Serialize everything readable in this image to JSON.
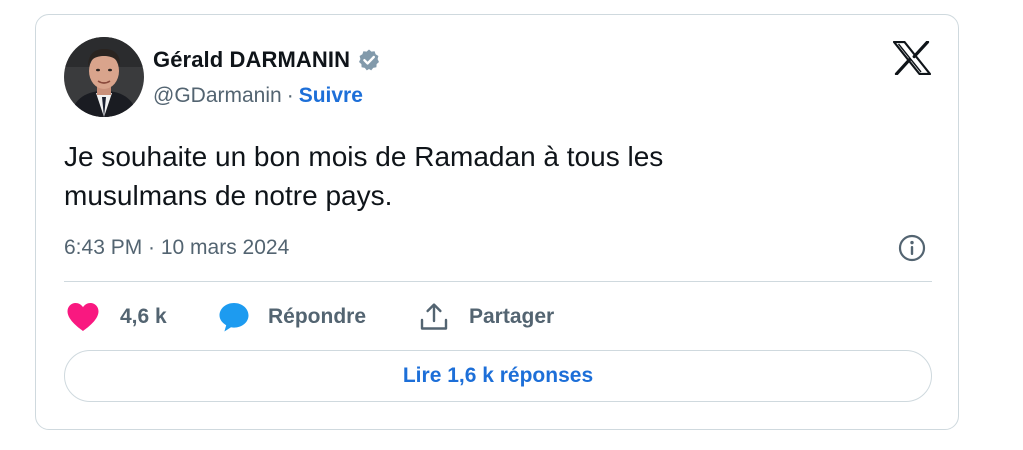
{
  "author": {
    "display_name": "Gérald DARMANIN",
    "handle": "@GDarmanin",
    "separator": "·",
    "follow_label": "Suivre",
    "verified": true,
    "verified_color": "#829aab"
  },
  "tweet": {
    "text_line_1": "Je souhaite un bon mois de Ramadan à tous les",
    "text_line_2": "musulmans de notre pays.",
    "timestamp": "6:43 PM · 10 mars 2024"
  },
  "actions": {
    "like_count": "4,6 k",
    "reply_label": "Répondre",
    "share_label": "Partager"
  },
  "replies_button_label": "Lire 1,6 k réponses",
  "colors": {
    "accent": "#1d6fd8",
    "like": "#f91880",
    "reply": "#1d9bf0",
    "muted_text": "#536471",
    "border": "#cfd9de"
  },
  "icons": {
    "brand": "x-logo-icon",
    "verified": "verified-badge-icon",
    "info": "info-icon",
    "like": "heart-icon",
    "reply": "speech-bubble-icon",
    "share": "share-upload-icon"
  }
}
